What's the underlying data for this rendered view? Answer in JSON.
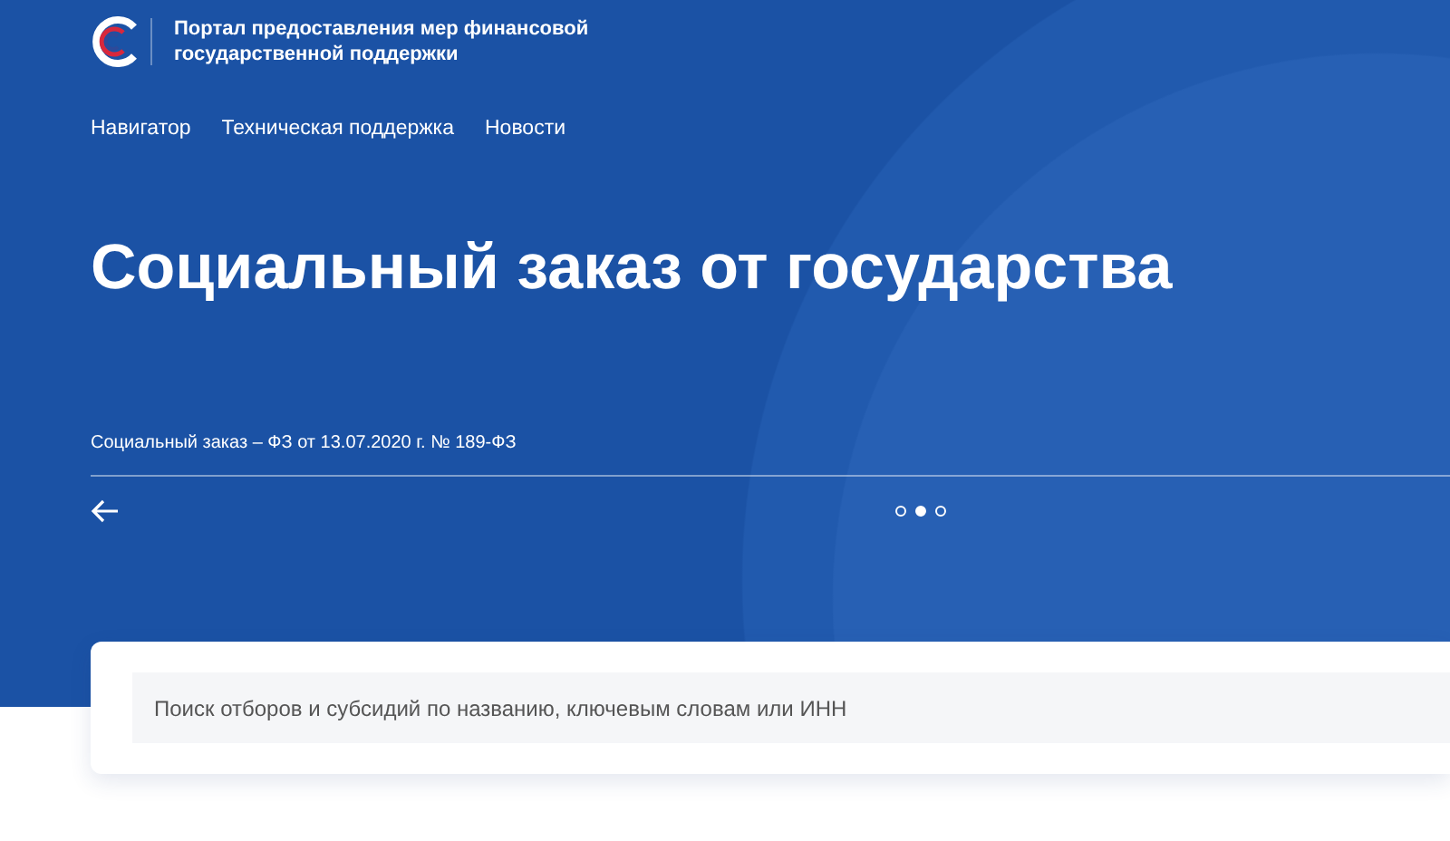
{
  "header": {
    "portal_title": "Портал предоставления мер финансовой государственной поддержки"
  },
  "nav": [
    {
      "label": "Навигатор"
    },
    {
      "label": "Техническая поддержка"
    },
    {
      "label": "Новости"
    }
  ],
  "hero": {
    "title": "Социальный заказ от государства",
    "caption": "Социальный заказ – ФЗ от 13.07.2020 г. № 189-ФЗ"
  },
  "slides": [
    {
      "selected": false
    },
    {
      "selected": true
    },
    {
      "selected": false
    }
  ],
  "search": {
    "placeholder": "Поиск отборов и субсидий по названию, ключевым словам или ИНН"
  }
}
